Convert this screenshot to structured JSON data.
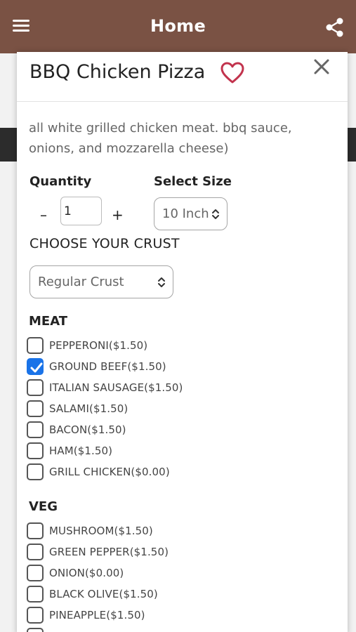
{
  "header": {
    "title": "Home",
    "menu_icon": "menu-icon",
    "share_icon": "share-icon",
    "bar_color": "#7a5244"
  },
  "product": {
    "name": "BBQ Chicken Pizza",
    "description": "all white grilled chicken meat. bbq sauce, onions, and mozzarella cheese)",
    "favorite_icon": "heart-icon",
    "close_icon": "close-icon"
  },
  "quantity": {
    "label": "Quantity",
    "value": "1",
    "minus": "–",
    "plus": "+"
  },
  "size": {
    "label": "Select Size",
    "selected": "10 Inch"
  },
  "crust": {
    "label": "CHOOSE YOUR CRUST",
    "selected": "Regular Crust"
  },
  "meat": {
    "title": "MEAT",
    "options": [
      {
        "label": "PEPPERONI($1.50)",
        "checked": false
      },
      {
        "label": "GROUND BEEF($1.50)",
        "checked": true
      },
      {
        "label": "ITALIAN SAUSAGE($1.50)",
        "checked": false
      },
      {
        "label": "SALAMI($1.50)",
        "checked": false
      },
      {
        "label": "BACON($1.50)",
        "checked": false
      },
      {
        "label": "HAM($1.50)",
        "checked": false
      },
      {
        "label": "GRILL CHICKEN($0.00)",
        "checked": false
      }
    ]
  },
  "veg": {
    "title": "VEG",
    "options": [
      {
        "label": "MUSHROOM($1.50)",
        "checked": false
      },
      {
        "label": "GREEN PEPPER($1.50)",
        "checked": false
      },
      {
        "label": "ONION($0.00)",
        "checked": false
      },
      {
        "label": "BLACK OLIVE($1.50)",
        "checked": false
      },
      {
        "label": "PINEAPPLE($1.50)",
        "checked": false
      }
    ]
  },
  "colors": {
    "accent_check": "#1a73e8",
    "heart": "#c2334d"
  }
}
